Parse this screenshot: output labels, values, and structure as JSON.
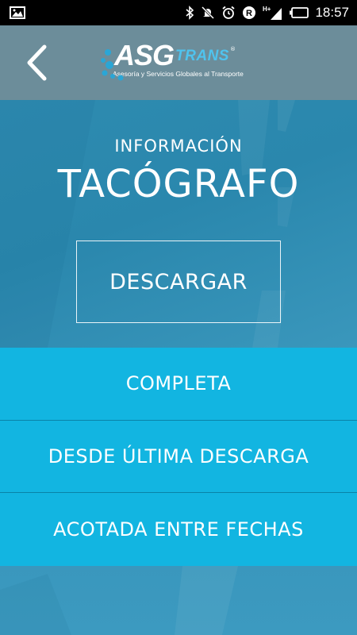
{
  "status_bar": {
    "time": "18:57",
    "network": "H+",
    "icons": [
      "image-icon",
      "bluetooth-icon",
      "mute-icon",
      "alarm-icon",
      "r-icon",
      "signal-icon",
      "battery-icon"
    ]
  },
  "header": {
    "back_icon": "chevron-left-icon",
    "logo": {
      "main": "ASG",
      "sub": "TRANS",
      "registered": "®",
      "tagline": "Asesoría y Servicios Globales al Transporte"
    }
  },
  "hero": {
    "subtitle": "INFORMACIÓN",
    "title": "TACÓGRAFO",
    "download_label": "DESCARGAR"
  },
  "options": [
    {
      "label": "COMPLETA"
    },
    {
      "label": "DESDE ÚLTIMA DESCARGA"
    },
    {
      "label": "ACOTADA ENTRE FECHAS"
    }
  ],
  "colors": {
    "accent": "#12b5e1",
    "header": "#6c8d9a",
    "background": "#2b8fb3"
  }
}
